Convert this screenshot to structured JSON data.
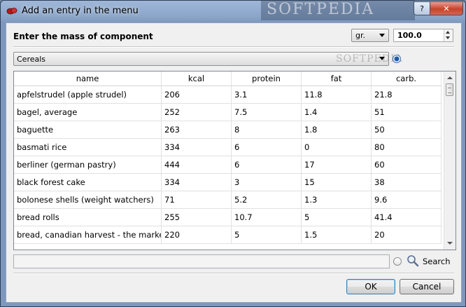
{
  "window": {
    "title": "Add an entry in the menu",
    "help_label": "?",
    "close_label": "✕",
    "watermark": "SOFTPEDIA"
  },
  "mass": {
    "label": "Enter the mass of component",
    "unit": "gr.",
    "value": "100.0"
  },
  "category": {
    "selected": "Cereals",
    "watermark": "SOFTPEDIA"
  },
  "table": {
    "columns": [
      "name",
      "kcal",
      "protein",
      "fat",
      "carb."
    ],
    "rows": [
      [
        "apfelstrudel (apple strudel)",
        "206",
        "3.1",
        "11.8",
        "21.8"
      ],
      [
        "bagel, average",
        "252",
        "7.5",
        "1.4",
        "51"
      ],
      [
        "baguette",
        "263",
        "8",
        "1.8",
        "50"
      ],
      [
        "basmati rice",
        "334",
        "6",
        "0",
        "80"
      ],
      [
        "berliner (german pastry)",
        "444",
        "6",
        "17",
        "60"
      ],
      [
        "black forest cake",
        "334",
        "3",
        "15",
        "38"
      ],
      [
        "bolonese shells (weight watchers)",
        "71",
        "5.2",
        "1.3",
        "9.6"
      ],
      [
        "bread rolls",
        "255",
        "10.7",
        "5",
        "41.4"
      ],
      [
        "bread, canadian harvest - the market...",
        "220",
        "5",
        "1.5",
        "20"
      ]
    ]
  },
  "search": {
    "value": "",
    "label": "Search"
  },
  "buttons": {
    "ok": "OK",
    "cancel": "Cancel"
  },
  "colors": {
    "titlebar": "#8aa4c8",
    "client_bg": "#f0f0f0",
    "close_button": "#c7432c",
    "default_button_border": "#3c7fb1"
  }
}
